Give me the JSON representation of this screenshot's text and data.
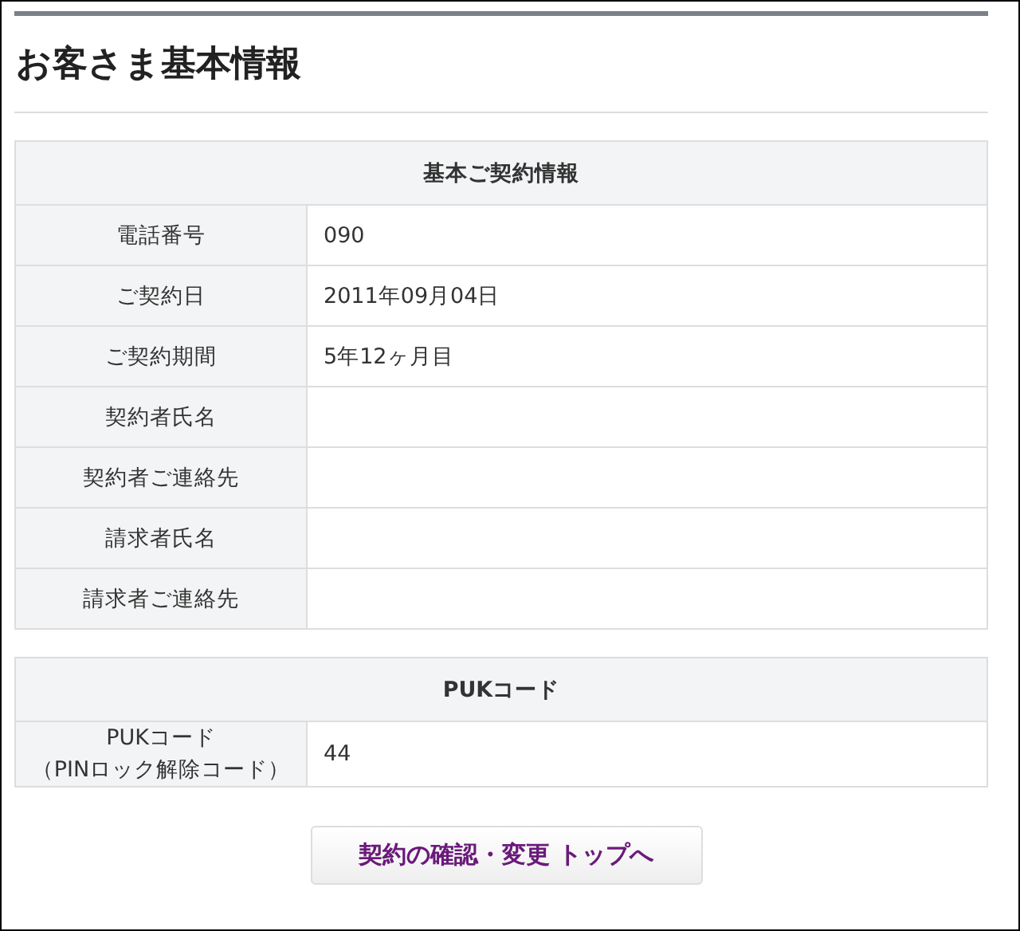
{
  "page_title": "お客さま基本情報",
  "sections": [
    {
      "heading": "基本ご契約情報",
      "rows": [
        {
          "label": "電話番号",
          "value": "090"
        },
        {
          "label": "ご契約日",
          "value": "2011年09月04日"
        },
        {
          "label": "ご契約期間",
          "value": "5年12ヶ月目"
        },
        {
          "label": "契約者氏名"
        },
        {
          "label": "契約者ご連絡先"
        },
        {
          "label": "請求者氏名"
        },
        {
          "label": "請求者ご連絡先"
        }
      ]
    },
    {
      "heading": "PUKコード",
      "rows": [
        {
          "label": "PUKコード",
          "label_sub": "（PINロック解除コード）",
          "value": "44"
        }
      ]
    }
  ],
  "button": "契約の確認・変更 トップへ"
}
